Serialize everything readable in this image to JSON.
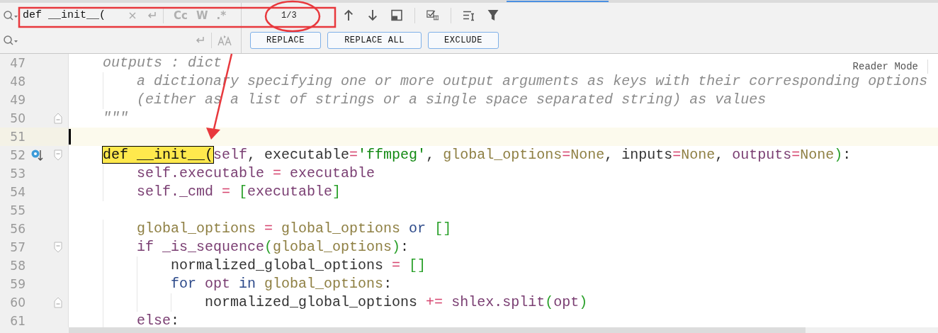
{
  "find_bar": {
    "search": {
      "value": "def __init__("
    },
    "options": [
      {
        "label": "Cc",
        "on": false
      },
      {
        "label": "W",
        "on": false
      },
      {
        "label": ".*",
        "on": false
      }
    ],
    "match_count": "1/3",
    "buttons": [
      "REPLACE",
      "REPLACE ALL",
      "EXCLUDE"
    ]
  },
  "editor": {
    "reader_mode": "Reader Mode",
    "lines": [
      {
        "number": "47",
        "current": false,
        "marker": false,
        "tokens": [
          {
            "kind": "comment",
            "text": "    outputs : dict"
          }
        ]
      },
      {
        "number": "48",
        "current": false,
        "marker": false,
        "tokens": [
          {
            "kind": "comment",
            "text": "        a dictionary specifying one or more output arguments as keys with their corresponding options"
          }
        ]
      },
      {
        "number": "49",
        "current": false,
        "marker": false,
        "tokens": [
          {
            "kind": "comment",
            "text": "        (either as a list of strings or a single space separated string) as values"
          }
        ]
      },
      {
        "number": "50",
        "current": false,
        "marker": false,
        "fold_end": true,
        "tokens": [
          {
            "kind": "comment",
            "text": "    \"\"\""
          }
        ]
      },
      {
        "number": "51",
        "current": true,
        "marker": false
      },
      {
        "number": "52",
        "current": false,
        "marker": true,
        "fold_start": true,
        "tokens": [
          {
            "kind": "match",
            "text": "    def __init__("
          },
          {
            "kind": "self",
            "text": "self"
          },
          {
            "kind": "text",
            "text": ", executable"
          },
          {
            "kind": "op",
            "text": "="
          },
          {
            "kind": "string",
            "text": "'ffmpeg'"
          },
          {
            "kind": "text",
            "text": ", "
          },
          {
            "kind": "var",
            "text": "global_options"
          },
          {
            "kind": "op",
            "text": "="
          },
          {
            "kind": "var",
            "text": "None"
          },
          {
            "kind": "text",
            "text": ", inputs"
          },
          {
            "kind": "op",
            "text": "="
          },
          {
            "kind": "var",
            "text": "None"
          },
          {
            "kind": "text",
            "text": ", "
          },
          {
            "kind": "self",
            "text": "outputs"
          },
          {
            "kind": "op",
            "text": "="
          },
          {
            "kind": "var",
            "text": "None"
          },
          {
            "kind": "bracket",
            "text": ")"
          },
          {
            "kind": "text",
            "text": ":"
          }
        ]
      },
      {
        "number": "53",
        "current": false,
        "marker": false,
        "tokens": [
          {
            "kind": "self",
            "text": "        self.executable "
          },
          {
            "kind": "op",
            "text": "="
          },
          {
            "kind": "self",
            "text": " executable"
          }
        ]
      },
      {
        "number": "54",
        "current": false,
        "marker": false,
        "tokens": [
          {
            "kind": "self",
            "text": "        self._cmd "
          },
          {
            "kind": "op",
            "text": "= "
          },
          {
            "kind": "bracket",
            "text": "["
          },
          {
            "kind": "self",
            "text": "executable"
          },
          {
            "kind": "bracket",
            "text": "]"
          }
        ]
      },
      {
        "number": "55",
        "current": false,
        "marker": false
      },
      {
        "number": "56",
        "current": false,
        "marker": false,
        "tokens": [
          {
            "kind": "var",
            "text": "        global_options "
          },
          {
            "kind": "op",
            "text": "= "
          },
          {
            "kind": "var",
            "text": "global_options"
          },
          {
            "kind": "keyword",
            "text": " or "
          },
          {
            "kind": "bracket",
            "text": "[]"
          }
        ]
      },
      {
        "number": "57",
        "current": false,
        "marker": false,
        "fold_start": true,
        "tokens": [
          {
            "kind": "self",
            "text": "        if _is_sequence"
          },
          {
            "kind": "bracket",
            "text": "("
          },
          {
            "kind": "var",
            "text": "global_options"
          },
          {
            "kind": "bracket",
            "text": ")"
          },
          {
            "kind": "text",
            "text": ":"
          }
        ]
      },
      {
        "number": "58",
        "current": false,
        "marker": false,
        "tokens": [
          {
            "kind": "text",
            "text": "            normalized_global_options "
          },
          {
            "kind": "op",
            "text": "= "
          },
          {
            "kind": "bracket",
            "text": "[]"
          }
        ]
      },
      {
        "number": "59",
        "current": false,
        "marker": false,
        "tokens": [
          {
            "kind": "keyword",
            "text": "            for "
          },
          {
            "kind": "self",
            "text": "opt"
          },
          {
            "kind": "keyword",
            "text": " in "
          },
          {
            "kind": "var",
            "text": "global_options"
          },
          {
            "kind": "text",
            "text": ":"
          }
        ]
      },
      {
        "number": "60",
        "current": false,
        "marker": false,
        "fold_end": true,
        "tokens": [
          {
            "kind": "text",
            "text": "                normalized_global_options "
          },
          {
            "kind": "op",
            "text": "+="
          },
          {
            "kind": "self",
            "text": " shlex.split"
          },
          {
            "kind": "bracket",
            "text": "("
          },
          {
            "kind": "self",
            "text": "opt"
          },
          {
            "kind": "bracket",
            "text": ")"
          }
        ]
      },
      {
        "number": "61",
        "current": false,
        "marker": false,
        "tokens": [
          {
            "kind": "self",
            "text": "        else"
          },
          {
            "kind": "text",
            "text": ":"
          }
        ]
      }
    ]
  }
}
